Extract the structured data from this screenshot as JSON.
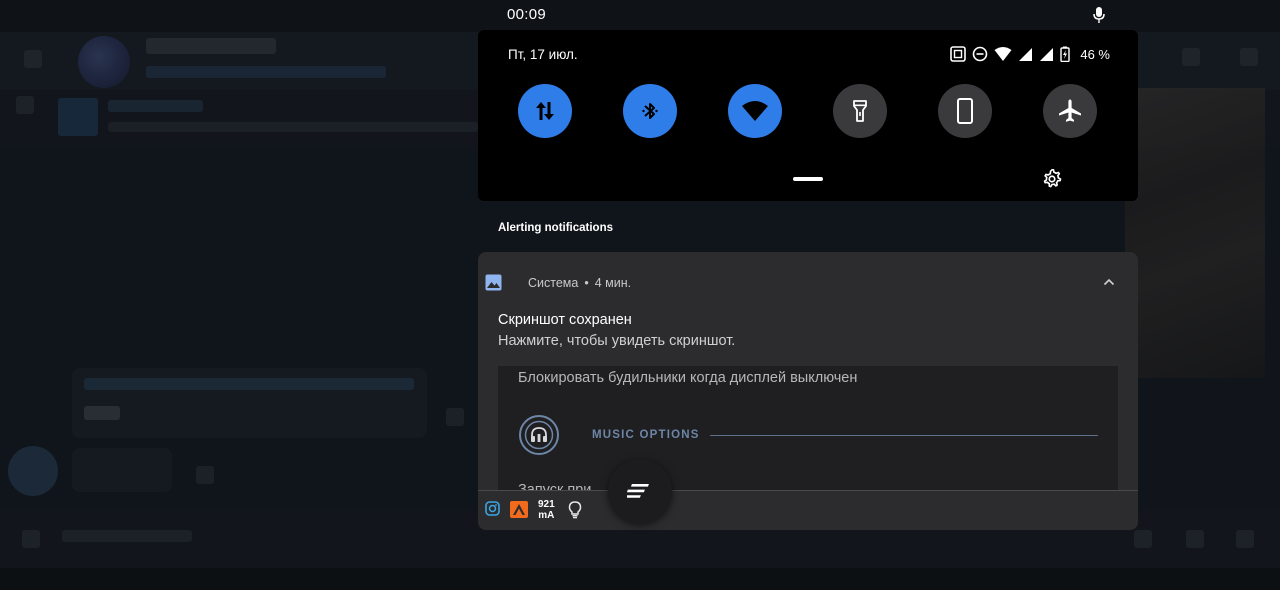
{
  "status_bar": {
    "time": "00:09"
  },
  "quick_settings": {
    "date": "Пт, 17 июл.",
    "battery_percent": "46 %",
    "tiles": [
      {
        "name": "mobile-data",
        "icon": "data-arrows-icon",
        "state": "on"
      },
      {
        "name": "bluetooth",
        "icon": "bluetooth-icon",
        "state": "on"
      },
      {
        "name": "wifi",
        "icon": "wifi-icon",
        "state": "on"
      },
      {
        "name": "flashlight",
        "icon": "flashlight-icon",
        "state": "off"
      },
      {
        "name": "auto-rotate",
        "icon": "phone-icon",
        "state": "off"
      },
      {
        "name": "airplane-mode",
        "icon": "airplane-icon",
        "state": "off"
      }
    ],
    "colors": {
      "tile_on": "#2f7de9",
      "tile_off": "#3a3a3c",
      "panel": "#000000"
    }
  },
  "notifications": {
    "section_label": "Alerting notifications",
    "items": [
      {
        "app": "Система",
        "time": "4 мин.",
        "title": "Скриншот сохранен",
        "text": "Нажмите, чтобы увидеть скриншот.",
        "preview": {
          "line1": "Блокировать будильники когда дисплей выключен",
          "section": "MUSIC OPTIONS",
          "partial_line": "Запуск при ... ...ора"
        }
      }
    ],
    "footer": {
      "current_value": "921",
      "current_unit": "mA"
    }
  }
}
